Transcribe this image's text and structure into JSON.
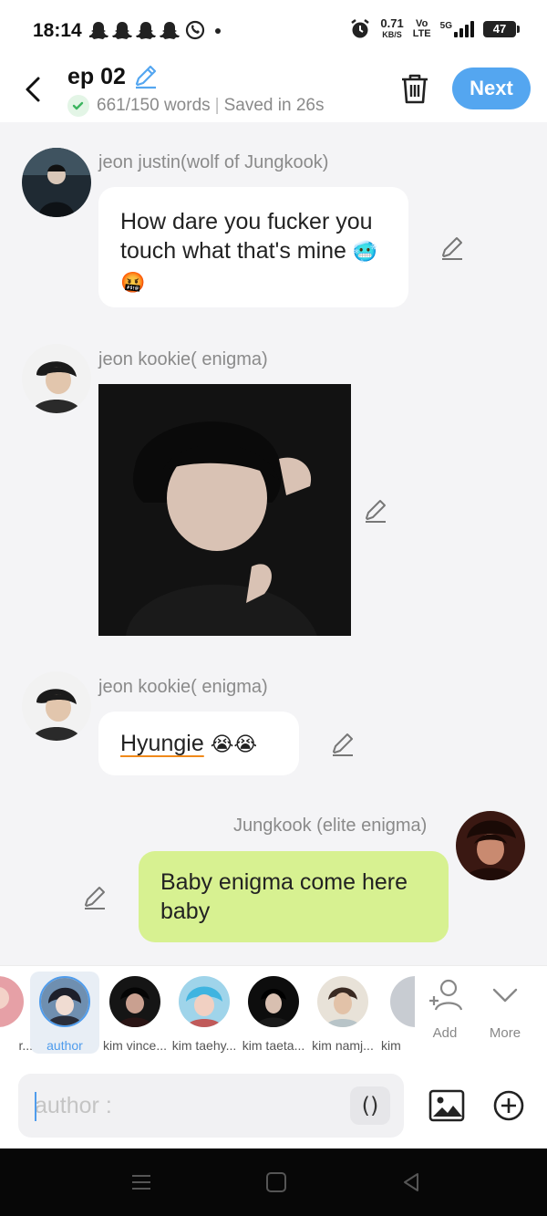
{
  "status_bar": {
    "time": "18:14",
    "net_speed": "0.71",
    "net_unit": "KB/S",
    "volte_top": "Vo",
    "volte_bottom": "LTE",
    "network": "5G",
    "battery": "47"
  },
  "header": {
    "title": "ep 02",
    "word_count": "661/150 words",
    "saved": "Saved in 26s",
    "next_label": "Next"
  },
  "messages": [
    {
      "sender": "jeon justin(wolf of Jungkook)",
      "text": "How dare you fucker you touch what that's mine",
      "emojis": "🥶🤬"
    },
    {
      "sender": "jeon kookie( enigma)",
      "type": "image"
    },
    {
      "sender": "jeon kookie( enigma)",
      "text": "Hyungie",
      "emojis": "😭😭"
    },
    {
      "sender": "Jungkook (elite enigma)",
      "text": "Baby enigma come here baby"
    }
  ],
  "characters": [
    {
      "name": "r..."
    },
    {
      "name": "author",
      "selected": true
    },
    {
      "name": "kim vince..."
    },
    {
      "name": "kim taehy..."
    },
    {
      "name": "kim taeta..."
    },
    {
      "name": "kim namj..."
    },
    {
      "name": "kim"
    }
  ],
  "controls": {
    "add_label": "Add",
    "more_label": "More"
  },
  "input": {
    "placeholder": "author :",
    "paren_label": "()"
  },
  "colors": {
    "accent": "#54a6f0",
    "green_bubble": "#d7f191",
    "background": "#f4f4f6"
  }
}
